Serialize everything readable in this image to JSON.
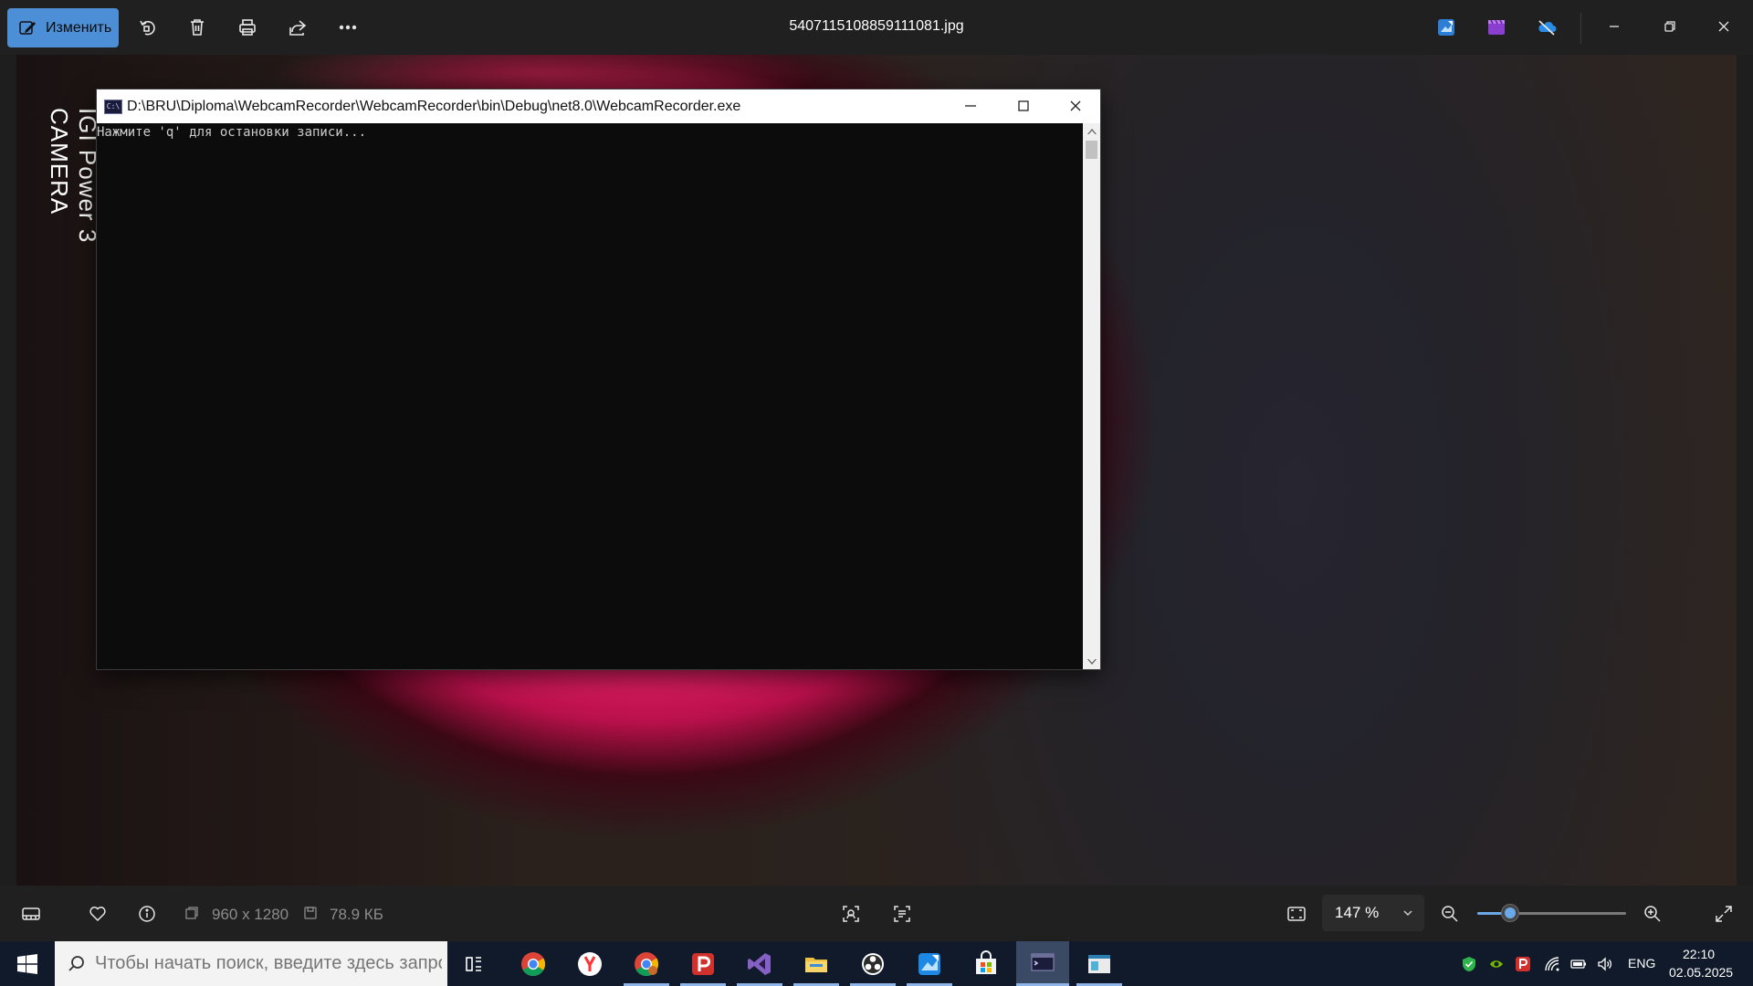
{
  "app": {
    "edit_button_label": "Изменить",
    "file_name": "5407115108859111081.jpg"
  },
  "photo": {
    "camera_label_line1": "IGI Power 3",
    "camera_label_line2": "CAMERA"
  },
  "console": {
    "title": "D:\\BRU\\Diploma\\WebcamRecorder\\WebcamRecorder\\bin\\Debug\\net8.0\\WebcamRecorder.exe",
    "icon_text": "C:\\",
    "output": "Нажмите 'q' для остановки записи..."
  },
  "infobar": {
    "dimensions": "960 x 1280",
    "file_size": "78.9 КБ",
    "zoom_label": "147 %",
    "zoom_fraction": 0.22
  },
  "taskbar": {
    "search_placeholder": "Чтобы начать поиск, введите здесь запрос",
    "language": "ENG",
    "time": "22:10",
    "date": "02.05.2025"
  },
  "colors": {
    "accent": "#4c8fd6",
    "console_bg": "#0c0c0c",
    "taskbar_bg": "#101a2a"
  },
  "icons": [
    "edit-icon",
    "rotate-icon",
    "delete-icon",
    "print-icon",
    "share-icon",
    "more-icon",
    "photo-editor-icon",
    "video-editor-icon",
    "onedrive-icon",
    "filmstrip-icon",
    "favorite-icon",
    "info-icon",
    "face-detect-icon",
    "text-detect-icon",
    "fit-icon",
    "zoom-out-icon",
    "zoom-in-icon",
    "fullscreen-icon"
  ]
}
